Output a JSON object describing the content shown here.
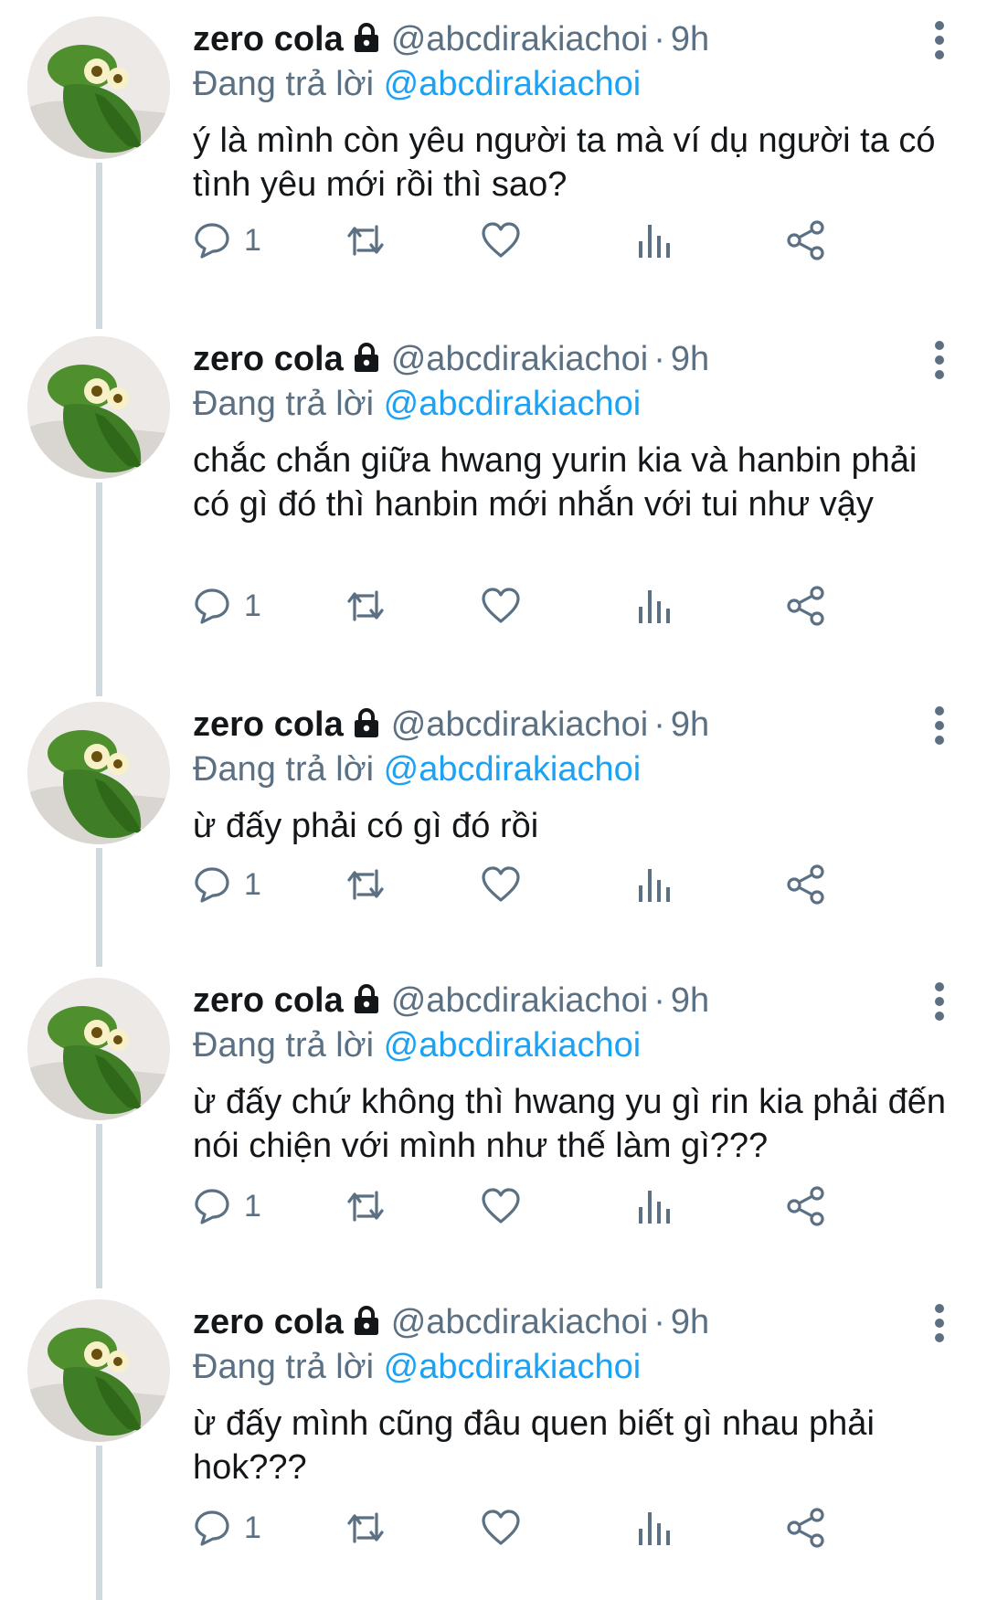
{
  "tweets": [
    {
      "name": "zero cola",
      "handle": "@abcdirakiachoi",
      "separator": "·",
      "time": "9h",
      "reply_prefix": "Đang trả lời",
      "reply_to": "@abcdirakiachoi",
      "text": "ý là mình còn yêu người ta mà ví dụ người ta có tình yêu mới rồi thì sao?",
      "reply_count": "1"
    },
    {
      "name": "zero cola",
      "handle": "@abcdirakiachoi",
      "separator": "·",
      "time": "9h",
      "reply_prefix": "Đang trả lời",
      "reply_to": "@abcdirakiachoi",
      "text": "chắc chắn giữa hwang yurin kia và hanbin phải có gì đó thì hanbin mới nhắn với tui như vậy",
      "reply_count": "1"
    },
    {
      "name": "zero cola",
      "handle": "@abcdirakiachoi",
      "separator": "·",
      "time": "9h",
      "reply_prefix": "Đang trả lời",
      "reply_to": "@abcdirakiachoi",
      "text": "ừ đấy phải có gì đó rồi",
      "reply_count": "1"
    },
    {
      "name": "zero cola",
      "handle": "@abcdirakiachoi",
      "separator": "·",
      "time": "9h",
      "reply_prefix": "Đang trả lời",
      "reply_to": "@abcdirakiachoi",
      "text": "ừ đấy chứ không thì hwang yu gì rin kia phải đến nói chiện với mình như thế làm gì???",
      "reply_count": "1"
    },
    {
      "name": "zero cola",
      "handle": "@abcdirakiachoi",
      "separator": "·",
      "time": "9h",
      "reply_prefix": "Đang trả lời",
      "reply_to": "@abcdirakiachoi",
      "text": "ừ đấy mình cũng đâu quen biết gì nhau phải hok???",
      "reply_count": "1"
    }
  ],
  "icons": {
    "lock": "lock-icon",
    "more": "more-vertical-icon",
    "reply": "reply-icon",
    "retweet": "retweet-icon",
    "like": "heart-icon",
    "analytics": "analytics-icon",
    "share": "share-icon"
  },
  "colors": {
    "link": "#1da1f2",
    "secondary_text": "#5b7083",
    "thread_line": "#cfd9de",
    "avatar_green": "#4f8f2e"
  }
}
